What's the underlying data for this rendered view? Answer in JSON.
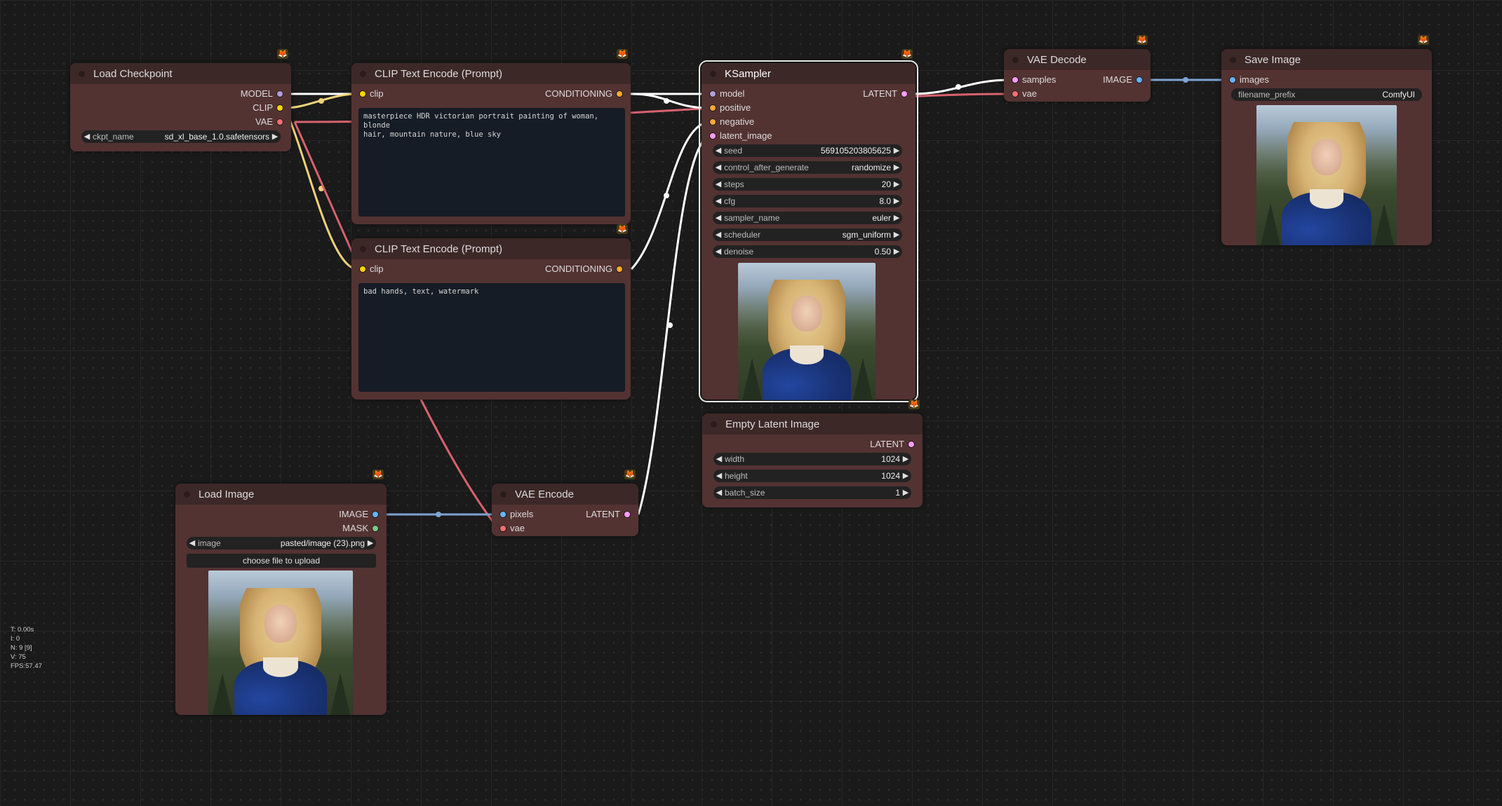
{
  "colors": {
    "model": "#b39ddb",
    "clip": "#ffd500",
    "vae": "#ff6e6e",
    "conditioning": "#ffa931",
    "latent": "#ff9cf9",
    "image": "#64b5f6",
    "mask": "#81c784",
    "wire_model": "#ffffff",
    "wire_clip": "#f2d27a",
    "wire_vae": "#d9626e",
    "wire_conditioning": "#ffffff",
    "wire_latent": "#ffffff",
    "wire_image": "#7fa3d4"
  },
  "nodes": {
    "load_checkpoint": {
      "title": "Load Checkpoint",
      "outputs": [
        "MODEL",
        "CLIP",
        "VAE"
      ],
      "widgets": [
        {
          "label": "ckpt_name",
          "value": "sd_xl_base_1.0.safetensors"
        }
      ]
    },
    "clip_pos": {
      "title": "CLIP Text Encode (Prompt)",
      "inputs": [
        "clip"
      ],
      "outputs": [
        "CONDITIONING"
      ],
      "text": "masterpiece HDR victorian portrait painting of woman, blonde\nhair, mountain nature, blue sky"
    },
    "clip_neg": {
      "title": "CLIP Text Encode (Prompt)",
      "inputs": [
        "clip"
      ],
      "outputs": [
        "CONDITIONING"
      ],
      "text": "bad hands, text, watermark"
    },
    "ksampler": {
      "title": "KSampler",
      "inputs": [
        "model",
        "positive",
        "negative",
        "latent_image"
      ],
      "outputs": [
        "LATENT"
      ],
      "widgets": [
        {
          "label": "seed",
          "value": "569105203805625"
        },
        {
          "label": "control_after_generate",
          "value": "randomize"
        },
        {
          "label": "steps",
          "value": "20"
        },
        {
          "label": "cfg",
          "value": "8.0"
        },
        {
          "label": "sampler_name",
          "value": "euler"
        },
        {
          "label": "scheduler",
          "value": "sgm_uniform"
        },
        {
          "label": "denoise",
          "value": "0.50"
        }
      ]
    },
    "vae_decode": {
      "title": "VAE Decode",
      "inputs": [
        "samples",
        "vae"
      ],
      "outputs": [
        "IMAGE"
      ]
    },
    "save_image": {
      "title": "Save Image",
      "inputs": [
        "images"
      ],
      "widgets": [
        {
          "label": "filename_prefix",
          "value": "ComfyUI"
        }
      ]
    },
    "empty_latent": {
      "title": "Empty Latent Image",
      "outputs": [
        "LATENT"
      ],
      "widgets": [
        {
          "label": "width",
          "value": "1024"
        },
        {
          "label": "height",
          "value": "1024"
        },
        {
          "label": "batch_size",
          "value": "1"
        }
      ]
    },
    "load_image": {
      "title": "Load Image",
      "outputs": [
        "IMAGE",
        "MASK"
      ],
      "widgets": [
        {
          "label": "image",
          "value": "pasted/image (23).png"
        }
      ],
      "button": "choose file to upload"
    },
    "vae_encode": {
      "title": "VAE Encode",
      "inputs": [
        "pixels",
        "vae"
      ],
      "outputs": [
        "LATENT"
      ]
    }
  },
  "stats": {
    "t": "T: 0.00s",
    "i": "I: 0",
    "n": "N: 9 [9]",
    "v": "V: 75",
    "fps": "FPS:57.47"
  },
  "badge_icon": "fox-badge-icon"
}
